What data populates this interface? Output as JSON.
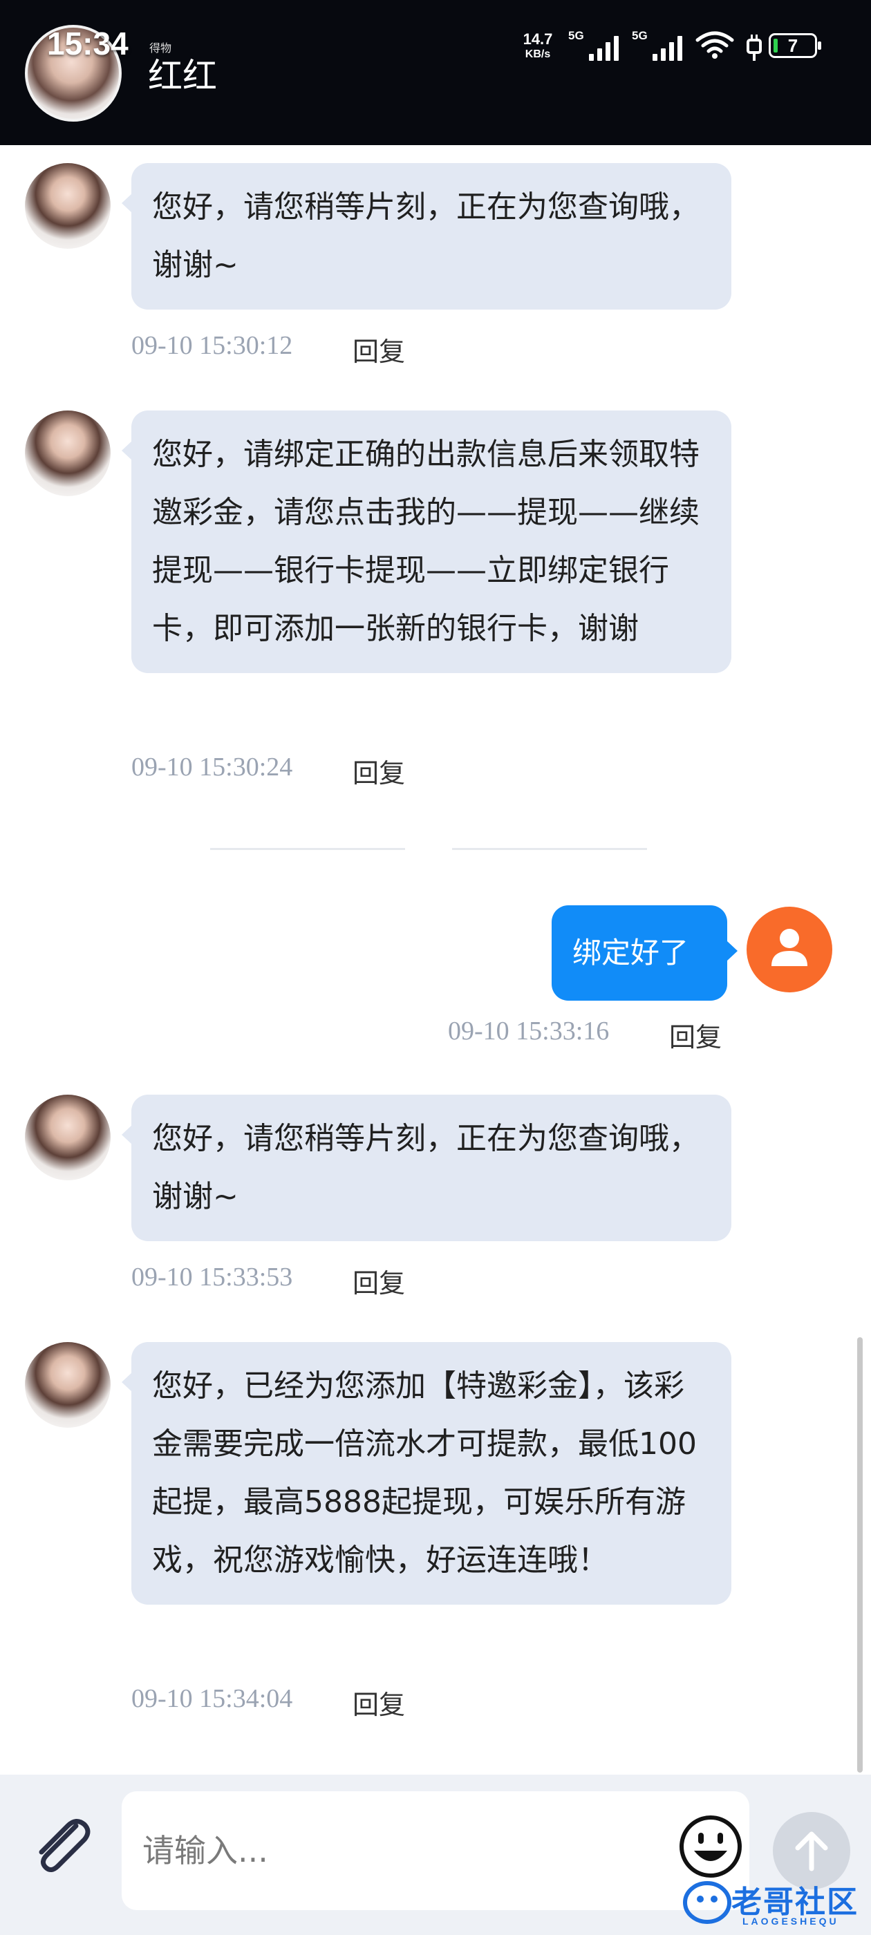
{
  "status_bar": {
    "time": "15:34",
    "net_speed_value": "14.7",
    "net_speed_unit": "KB/s",
    "signal_1_label": "5G",
    "signal_2_label": "5G",
    "battery_level": "7"
  },
  "header": {
    "tag": "得物",
    "contact_name": "红红"
  },
  "messages": [
    {
      "direction": "in",
      "text": "您好，请您稍等片刻，正在为您查询哦，谢谢~",
      "time": "09-10 15:30:12",
      "reply_label": "回复"
    },
    {
      "direction": "in",
      "text": "您好，请绑定正确的出款信息后来领取特邀彩金，请您点击我的——提现——继续提现——银行卡提现——立即绑定银行卡，即可添加一张新的银行卡，谢谢",
      "time": "09-10 15:30:24",
      "reply_label": "回复"
    },
    {
      "direction": "out",
      "text": "绑定好了",
      "time": "09-10 15:33:16",
      "reply_label": "回复"
    },
    {
      "direction": "in",
      "text": "您好，请您稍等片刻，正在为您查询哦，谢谢~",
      "time": "09-10 15:33:53",
      "reply_label": "回复"
    },
    {
      "direction": "in",
      "text": "您好，已经为您添加【特邀彩金】，该彩金需要完成一倍流水才可提款，最低100起提，最高5888起提现，可娱乐所有游戏，祝您游戏愉快，好运连连哦！",
      "time": "09-10 15:34:04",
      "reply_label": "回复"
    }
  ],
  "composer": {
    "placeholder": "请输入...",
    "value": ""
  },
  "watermark": {
    "text": "老哥社区",
    "sub": "LAOGESHEQU"
  },
  "colors": {
    "incoming_bubble": "#e2e8f3",
    "outgoing_bubble": "#118cf8",
    "user_avatar": "#f96b2a",
    "status_bar_bg": "#07090f",
    "composer_bg": "#eef1f6"
  },
  "icons": [
    "paperclip-icon",
    "emoji-icon",
    "arrow-up-icon",
    "user-icon",
    "wifi-icon",
    "charging-icon"
  ]
}
